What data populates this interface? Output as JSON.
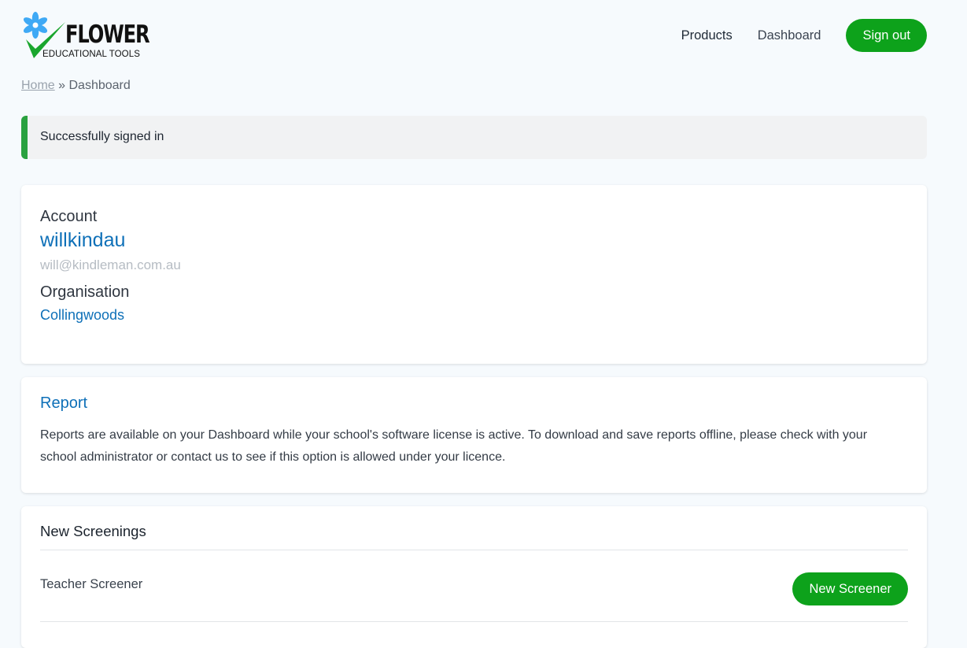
{
  "brand": {
    "name": "FLOWER",
    "subtitle": "EDUCATIONAL TOOLS",
    "accent": "#0da21b",
    "flower_color": "#3fa9f5"
  },
  "nav": {
    "products": "Products",
    "dashboard": "Dashboard",
    "sign_out": "Sign out"
  },
  "breadcrumb": {
    "home": "Home",
    "separator": "»",
    "current": "Dashboard"
  },
  "alert": {
    "message": "Successfully signed in",
    "color": "#2aa13f"
  },
  "account": {
    "label": "Account",
    "username": "willkindau",
    "email": "will@kindleman.com.au",
    "org_label": "Organisation",
    "org_name": "Collingwoods"
  },
  "report": {
    "title": "Report",
    "text": "Reports are available on your Dashboard while your school's software license is active. To download and save reports offline, please check with your school administrator or contact us to see if this option is allowed under your licence."
  },
  "screenings": {
    "title": "New Screenings",
    "items": [
      {
        "label": "Teacher Screener",
        "button": "New Screener"
      }
    ]
  }
}
